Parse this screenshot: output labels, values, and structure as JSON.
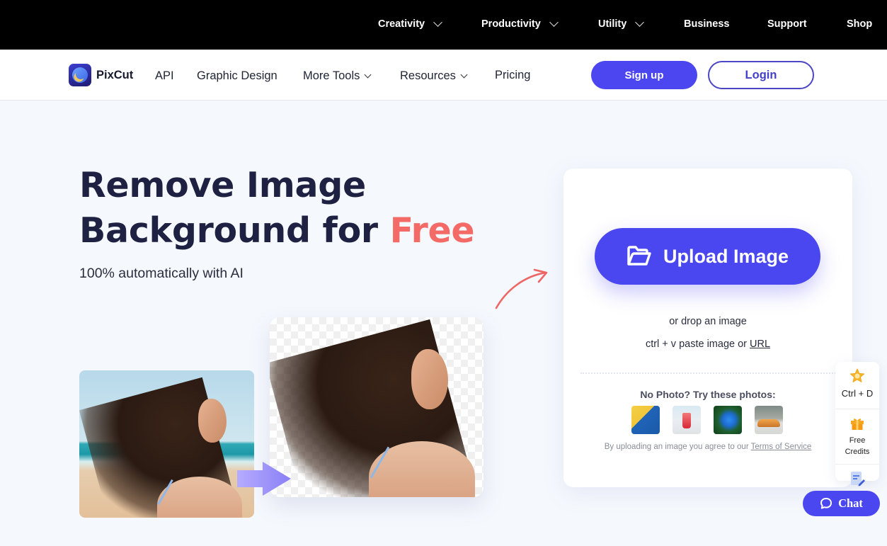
{
  "topbar": {
    "items": [
      {
        "label": "Creativity",
        "has_dropdown": true
      },
      {
        "label": "Productivity",
        "has_dropdown": true
      },
      {
        "label": "Utility",
        "has_dropdown": true
      },
      {
        "label": "Business",
        "has_dropdown": false
      },
      {
        "label": "Support",
        "has_dropdown": false
      },
      {
        "label": "Shop",
        "has_dropdown": false
      }
    ]
  },
  "nav": {
    "brand": "PixCut",
    "links": [
      {
        "label": "API",
        "has_dropdown": false
      },
      {
        "label": "Graphic Design",
        "has_dropdown": false
      },
      {
        "label": "More Tools",
        "has_dropdown": true
      },
      {
        "label": "Resources",
        "has_dropdown": true
      },
      {
        "label": "Pricing",
        "has_dropdown": false
      }
    ],
    "signup_label": "Sign up",
    "login_label": "Login"
  },
  "hero": {
    "title_line1": "Remove Image",
    "title_line2_prefix": "Background for ",
    "title_accent": "Free",
    "subtitle": "100% automatically with AI",
    "accent_color": "#f46a67"
  },
  "upload": {
    "button_label": "Upload Image",
    "button_icon": "folder-open-icon",
    "drop_text": "or drop an image",
    "paste_prefix": "ctrl + v paste image or ",
    "url_link": "URL",
    "samples_title": "No Photo? Try these photos:",
    "samples": [
      {
        "name": "man-in-blue-shirt"
      },
      {
        "name": "red-drink"
      },
      {
        "name": "blue-parrot"
      },
      {
        "name": "orange-sports-car"
      }
    ],
    "terms_prefix": "By uploading an image you agree to our ",
    "terms_link": "Terms of Service"
  },
  "side_panel": {
    "bookmark_label": "Ctrl + D",
    "credits_line1": "Free",
    "credits_line2": "Credits"
  },
  "chat": {
    "label": "Chat"
  },
  "colors": {
    "primary": "#4a46f0",
    "dark_text": "#1e2142",
    "accent": "#f46a67"
  }
}
